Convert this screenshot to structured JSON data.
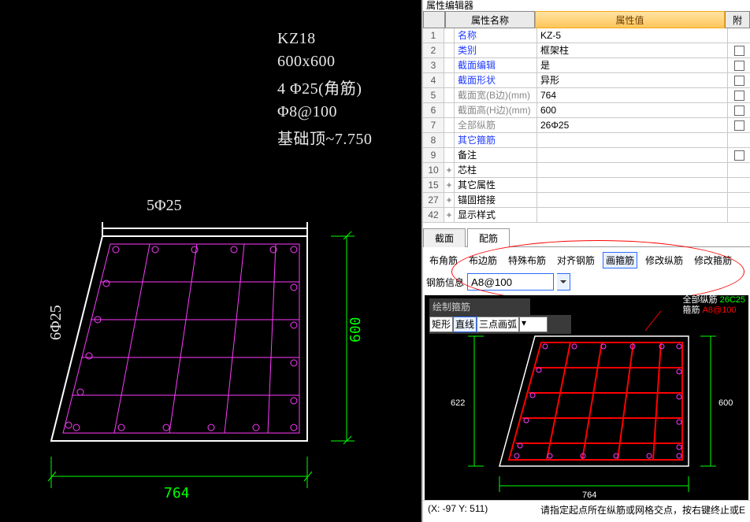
{
  "cad": {
    "notes": [
      "KZ18",
      "600x600",
      "4 Φ25(角筋)",
      "Φ8@100",
      "基础顶~7.750"
    ],
    "dim_top_note": "5Φ25",
    "dim_left_note": "6Φ25",
    "dim_bottom_value": "764",
    "dim_right_value": "600"
  },
  "right_title": "属性编辑器",
  "prop_header": {
    "name": "属性名称",
    "value": "属性值",
    "extra": "附"
  },
  "props": [
    {
      "idx": "1",
      "name": "名称",
      "val": "KZ-5",
      "link": true
    },
    {
      "idx": "2",
      "name": "类别",
      "val": "框架柱",
      "link": true,
      "chk": true
    },
    {
      "idx": "3",
      "name": "截面编辑",
      "val": "是",
      "link": true,
      "chk": true
    },
    {
      "idx": "4",
      "name": "截面形状",
      "val": "异形",
      "link": true,
      "chk": true
    },
    {
      "idx": "5",
      "name": "截面宽(B边)(mm)",
      "val": "764",
      "gray": true,
      "chk": true
    },
    {
      "idx": "6",
      "name": "截面高(H边)(mm)",
      "val": "600",
      "gray": true,
      "chk": true
    },
    {
      "idx": "7",
      "name": "全部纵筋",
      "val": "26Φ25",
      "gray": true,
      "chk": true
    },
    {
      "idx": "8",
      "name": "其它箍筋",
      "val": "",
      "link": true
    },
    {
      "idx": "9",
      "name": "备注",
      "val": "",
      "chk": true
    }
  ],
  "prop_groups": [
    {
      "idx": "10",
      "name": "芯柱"
    },
    {
      "idx": "15",
      "name": "其它属性"
    },
    {
      "idx": "27",
      "name": "锚固搭接"
    },
    {
      "idx": "42",
      "name": "显示样式"
    }
  ],
  "section_tabs": {
    "a": "截面",
    "b": "配筋"
  },
  "actions": {
    "a1": "布角筋",
    "a2": "布边筋",
    "a3": "特殊布筋",
    "a4": "对齐钢筋",
    "a5": "画箍筋",
    "a6": "修改纵筋",
    "a7": "修改箍筋"
  },
  "rebar": {
    "label": "钢筋信息",
    "value": "A8@100"
  },
  "mini": {
    "title": "绘制箍筋",
    "dd1": "矩形",
    "dd2": "直线",
    "dd3": "三点画弧",
    "dd4": "",
    "note_k1": "全部纵筋",
    "note_v1": "26C25",
    "note_k2": "箍筋",
    "note_v2": "A8@100",
    "dim_b": "764",
    "dim_h": "600",
    "dim_l": "622"
  },
  "status": {
    "coord": "(X: -97 Y: 511)",
    "hint": "请指定起点所在纵筋或网格交点，按右键终止或E"
  }
}
